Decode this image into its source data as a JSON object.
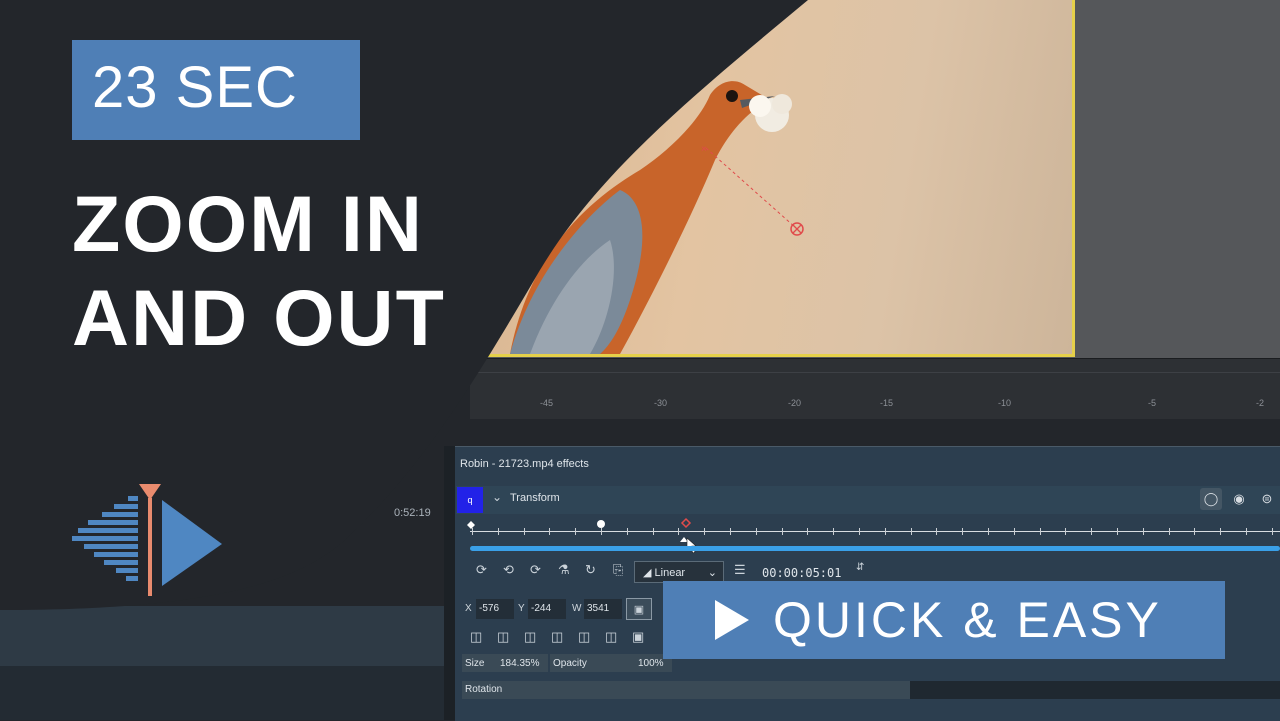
{
  "overlay": {
    "duration_badge": "23 SEC",
    "headline_line1": "ZOOM IN",
    "headline_line2": "AND OUT",
    "tagline": "QUICK & EASY",
    "accent": "#4f7fb6"
  },
  "ruler": {
    "labels": [
      "-45",
      "-30",
      "-20",
      "-15",
      "-10",
      "-5",
      "-2"
    ]
  },
  "effects_panel": {
    "title": "Robin - 21723.mp4 effects",
    "effect_name": "Transform",
    "badge": "q",
    "interpolation": "Linear",
    "timecode": "00:00:05:01",
    "fields": {
      "x_label": "X",
      "x_value": "-576",
      "y_label": "Y",
      "y_value": "-244",
      "w_label": "W",
      "w_value": "3541",
      "size_label": "Size",
      "size_value": "184.35%",
      "opacity_label": "Opacity",
      "opacity_value": "100%",
      "rotation_label": "Rotation"
    }
  },
  "clip_timecode": "0:52:19"
}
